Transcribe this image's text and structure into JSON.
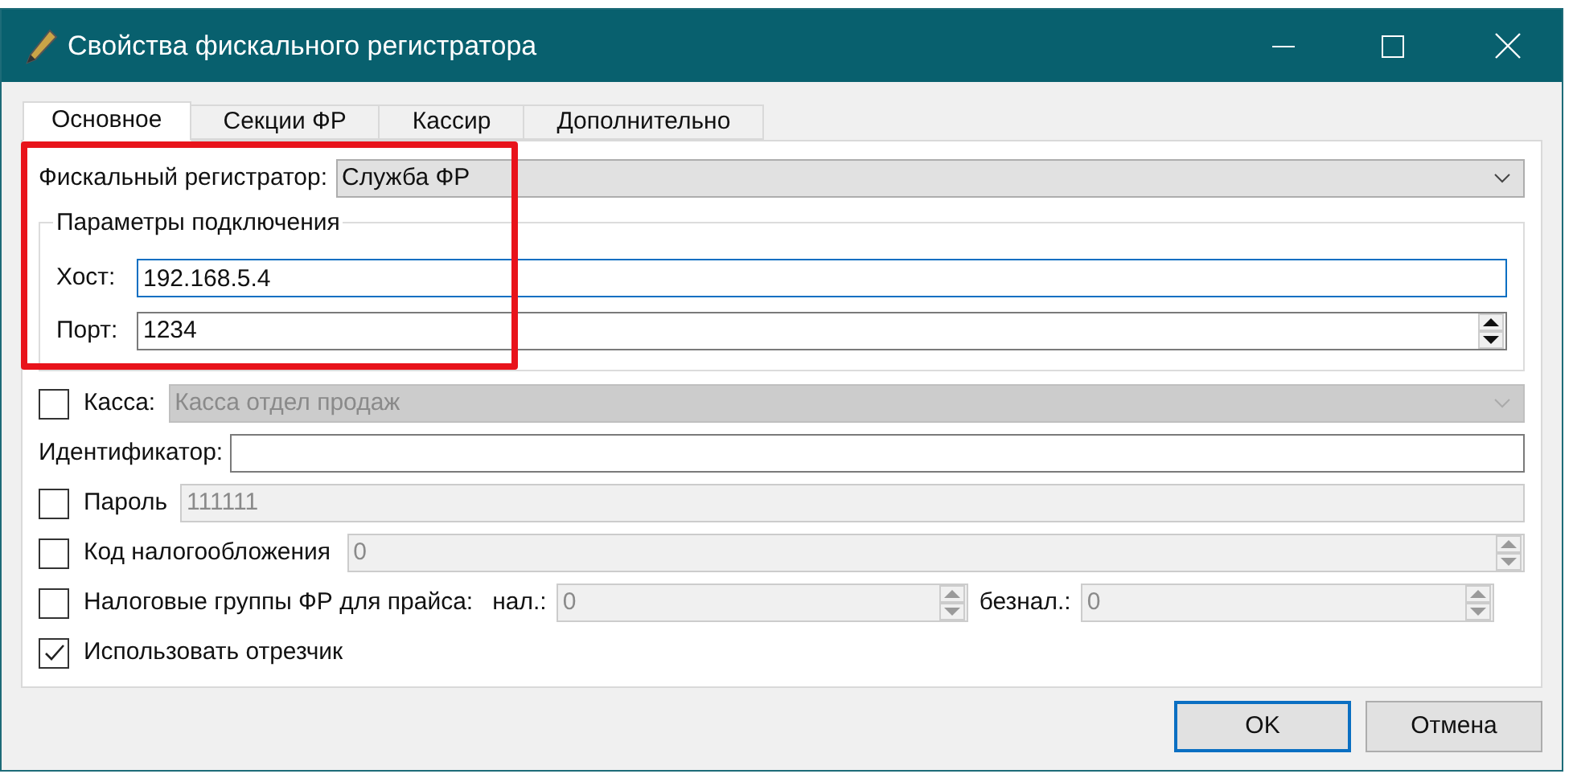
{
  "window": {
    "title": "Свойства фискального регистратора"
  },
  "tabs": [
    {
      "label": "Основное",
      "selected": true
    },
    {
      "label": "Секции ФР",
      "selected": false
    },
    {
      "label": "Кассир",
      "selected": false
    },
    {
      "label": "Дополнительно",
      "selected": false
    }
  ],
  "fiscal_registrar": {
    "label": "Фискальный регистратор:",
    "value": "Служба ФР"
  },
  "connection_group": {
    "title": "Параметры подключения",
    "host": {
      "label": "Хост:",
      "value": "192.168.5.4",
      "focused": true
    },
    "port": {
      "label": "Порт:",
      "value": "1234"
    }
  },
  "rows": [
    {
      "kind": "check_combo",
      "label": "Касса:",
      "checked": false,
      "disabled": true,
      "value": "Касса отдел продаж"
    },
    {
      "kind": "text",
      "label": "Идентификатор:"
    },
    {
      "kind": "check_field",
      "label": "Пароль",
      "checked": false,
      "disabled": true,
      "value": "111111"
    },
    {
      "kind": "check_spin",
      "label": "Код налогообложения",
      "checked": false,
      "disabled": true,
      "value": "0"
    },
    {
      "kind": "check_two_spins",
      "label": "Налоговые группы ФР для прайса:",
      "checked": false,
      "disabled": true,
      "spins": [
        {
          "label": "нал.:",
          "value": "0"
        },
        {
          "label": "безнал.:",
          "value": "0"
        }
      ]
    },
    {
      "kind": "check",
      "label": "Использовать отрезчик",
      "checked": true
    }
  ],
  "buttons": [
    {
      "label": "OK",
      "default": true
    },
    {
      "label": "Отмена",
      "default": false
    }
  ]
}
